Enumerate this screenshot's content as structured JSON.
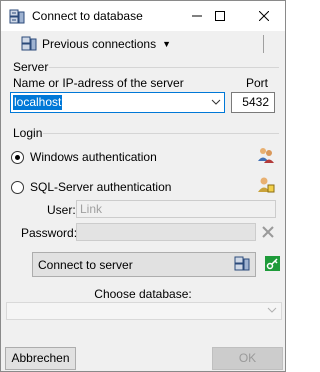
{
  "window": {
    "title": "Connect to database"
  },
  "toolbar": {
    "previous_connections_label": "Previous connections"
  },
  "server": {
    "group_label": "Server",
    "name_label": "Name or IP-adress of the server",
    "name_value": "localhost",
    "port_label": "Port",
    "port_value": "5432"
  },
  "login": {
    "group_label": "Login",
    "windows_auth_label": "Windows authentication",
    "sql_auth_label": "SQL-Server authentication",
    "selected": "windows",
    "user_label": "User:",
    "user_value": "Link",
    "password_label": "Password:",
    "password_value": ""
  },
  "connect": {
    "button_label": "Connect to server"
  },
  "database": {
    "choose_label": "Choose database:",
    "selected": ""
  },
  "footer": {
    "cancel_label": "Abbrechen",
    "ok_label": "OK"
  },
  "colors": {
    "selection": "#0078d7",
    "key_icon": "#1e9b3a",
    "window_bg": "#f0f0f0"
  },
  "icons": {
    "app": "database-connection-icon",
    "previous_connections": "database-connection-icon",
    "windows_auth": "users-icon",
    "sql_auth": "user-key-icon",
    "clear": "close-icon",
    "connect": "database-connection-icon",
    "key": "key-icon"
  }
}
